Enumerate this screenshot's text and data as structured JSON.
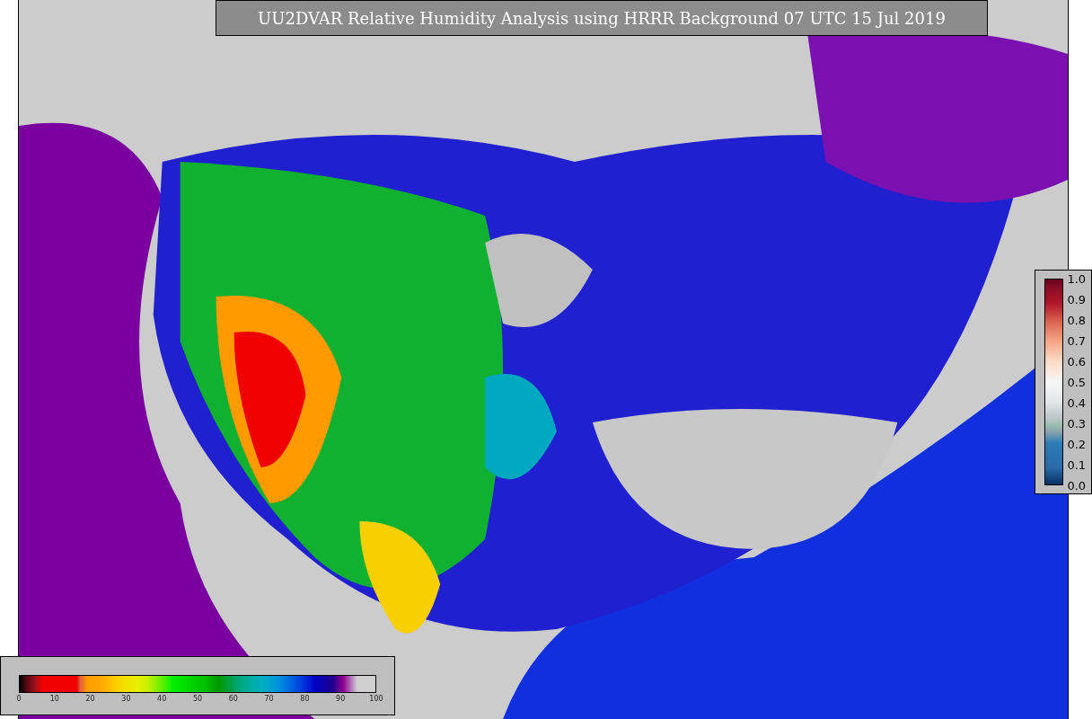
{
  "title": "UU2DVAR Relative Humidity Analysis using HRRR Background 07 UTC 15 Jul 2019",
  "humidity_colorbar": {
    "ticks": [
      "0",
      "10",
      "20",
      "30",
      "40",
      "50",
      "60",
      "70",
      "80",
      "90",
      "100"
    ]
  },
  "ratio_colorbar": {
    "ticks": [
      "1.0",
      "0.9",
      "0.8",
      "0.7",
      "0.6",
      "0.5",
      "0.4",
      "0.3",
      "0.2",
      "0.1",
      "0.0"
    ]
  }
}
